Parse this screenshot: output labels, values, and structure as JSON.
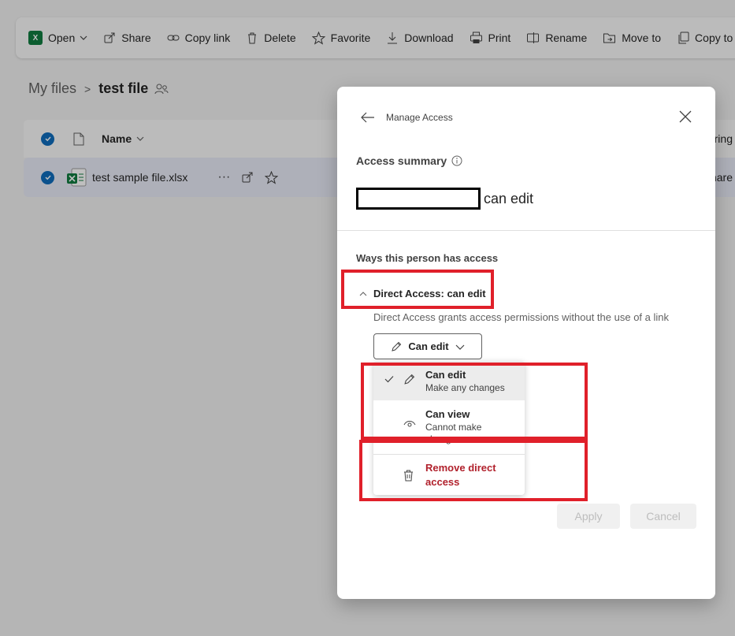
{
  "toolbar": {
    "open": "Open",
    "excel_badge": "X",
    "share": "Share",
    "copy_link": "Copy link",
    "delete": "Delete",
    "favorite": "Favorite",
    "download": "Download",
    "print": "Print",
    "rename": "Rename",
    "move_to": "Move to",
    "copy_to": "Copy to"
  },
  "breadcrumb": {
    "root": "My files",
    "separator": ">",
    "current": "test file"
  },
  "file_list": {
    "column_name": "Name",
    "right_header": "ring",
    "rows": [
      {
        "name": "test sample file.xlsx",
        "right": "hare"
      }
    ]
  },
  "panel": {
    "title": "Manage Access",
    "access_summary_label": "Access summary",
    "user_permission": "can edit",
    "ways_label": "Ways this person has access",
    "direct_access_title": "Direct Access: can edit",
    "direct_access_desc": "Direct Access grants access permissions without the use of a link",
    "permission_button": "Can edit",
    "menu": {
      "can_edit": {
        "title": "Can edit",
        "sub": "Make any changes"
      },
      "can_view": {
        "title": "Can view",
        "sub": "Cannot make changes"
      },
      "remove": "Remove direct access"
    },
    "apply": "Apply",
    "cancel": "Cancel"
  },
  "colors": {
    "accent": "#0f6cbd",
    "excel_green": "#107c41",
    "danger": "#b1212c",
    "annotation_red": "#e0202a"
  }
}
